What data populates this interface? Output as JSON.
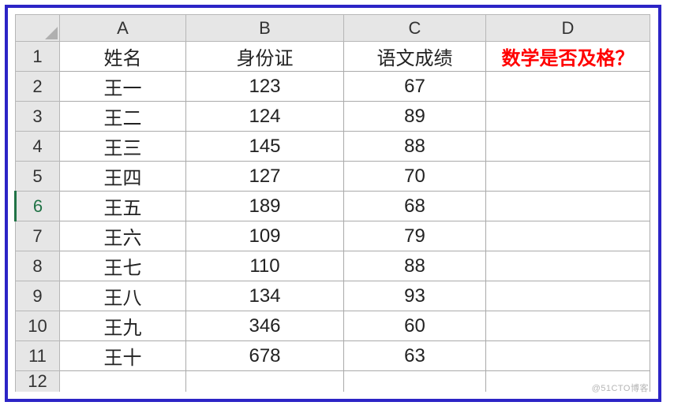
{
  "columns": [
    "A",
    "B",
    "C",
    "D"
  ],
  "header_row": {
    "num": "1",
    "A": "姓名",
    "B": "身份证",
    "C": "语文成绩",
    "D": "数学是否及格？"
  },
  "rows": [
    {
      "num": "2",
      "A": "王一",
      "B": "123",
      "C": "67",
      "D": ""
    },
    {
      "num": "3",
      "A": "王二",
      "B": "124",
      "C": "89",
      "D": ""
    },
    {
      "num": "4",
      "A": "王三",
      "B": "145",
      "C": "88",
      "D": ""
    },
    {
      "num": "5",
      "A": "王四",
      "B": "127",
      "C": "70",
      "D": ""
    },
    {
      "num": "6",
      "A": "王五",
      "B": "189",
      "C": "68",
      "D": "",
      "active": true
    },
    {
      "num": "7",
      "A": "王六",
      "B": "109",
      "C": "79",
      "D": ""
    },
    {
      "num": "8",
      "A": "王七",
      "B": "110",
      "C": "88",
      "D": ""
    },
    {
      "num": "9",
      "A": "王八",
      "B": "134",
      "C": "93",
      "D": ""
    },
    {
      "num": "10",
      "A": "王九",
      "B": "346",
      "C": "60",
      "D": ""
    },
    {
      "num": "11",
      "A": "王十",
      "B": "678",
      "C": "63",
      "D": ""
    }
  ],
  "cutoff_row_num": "12",
  "watermark": "@51CTO博客",
  "colors": {
    "frame_border": "#2c24c6",
    "header_bg": "#e6e6e6",
    "grid_line": "#aaaaaa",
    "red_text": "#ff0000",
    "active_green": "#217346"
  }
}
